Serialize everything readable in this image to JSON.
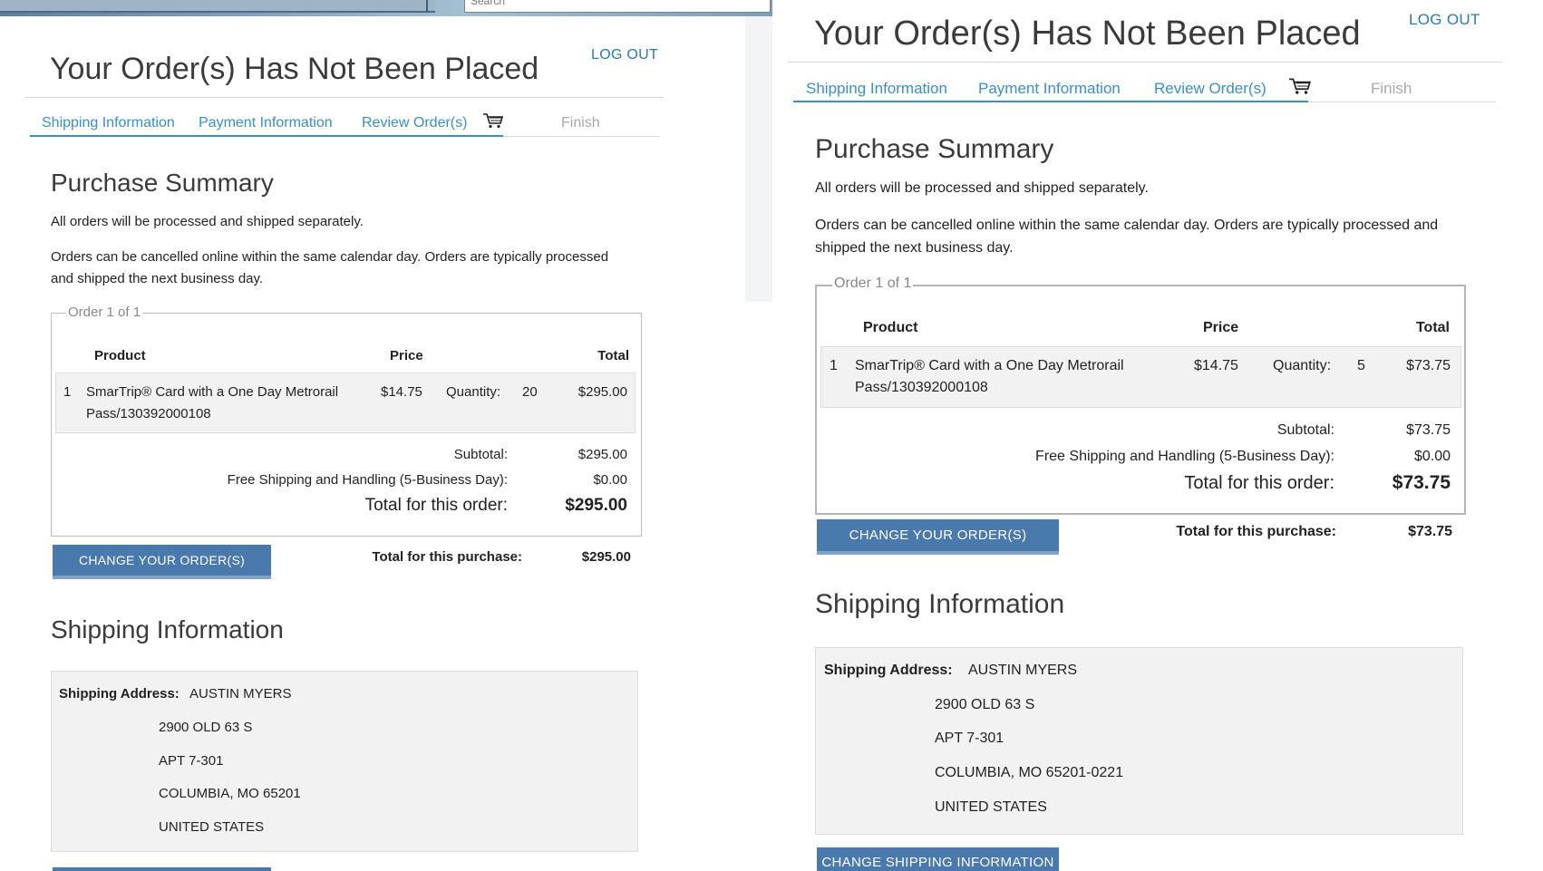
{
  "browser": {
    "search_placeholder": "Search"
  },
  "left": {
    "title": "Your Order(s) Has Not Been Placed",
    "logout": "LOG OUT",
    "steps": [
      "Shipping Information",
      "Payment Information",
      "Review Order(s)",
      "Finish"
    ],
    "summary_heading": "Purchase Summary",
    "note1": "All orders will be processed and shipped separately.",
    "note2": "Orders can be cancelled online within the same calendar day. Orders are typically processed and shipped the next business day.",
    "order_legend": "Order 1 of 1",
    "headers": {
      "product": "Product",
      "price": "Price",
      "total": "Total"
    },
    "item": {
      "index": "1",
      "product": "SmarTrip® Card with a One Day Metrorail Pass/130392000108",
      "price": "$14.75",
      "quantity_label": "Quantity:",
      "quantity": "20",
      "total": "$295.00"
    },
    "subtotal_label": "Subtotal:",
    "subtotal": "$295.00",
    "shipping_label": "Free Shipping and Handling (5-Business Day):",
    "shipping": "$0.00",
    "order_total_label": "Total for this order:",
    "order_total": "$295.00",
    "change_order_button": "CHANGE YOUR ORDER(S)",
    "purchase_total_label": "Total for this purchase:",
    "purchase_total": "$295.00",
    "shipping_heading": "Shipping Information",
    "address_label": "Shipping Address:",
    "address": [
      "AUSTIN MYERS",
      "2900 OLD 63 S",
      "APT 7-301",
      "COLUMBIA, MO 65201",
      "UNITED STATES"
    ]
  },
  "right": {
    "title": "Your Order(s) Has Not Been Placed",
    "logout": "LOG OUT",
    "steps": [
      "Shipping Information",
      "Payment Information",
      "Review Order(s)",
      "Finish"
    ],
    "summary_heading": "Purchase Summary",
    "note1": "All orders will be processed and shipped separately.",
    "note2": "Orders can be cancelled online within the same calendar day. Orders are typically processed and shipped the next business day.",
    "order_legend": "Order 1 of 1",
    "headers": {
      "product": "Product",
      "price": "Price",
      "total": "Total"
    },
    "item": {
      "index": "1",
      "product": "SmarTrip® Card with a One Day Metrorail Pass/130392000108",
      "price": "$14.75",
      "quantity_label": "Quantity:",
      "quantity": "5",
      "total": "$73.75"
    },
    "subtotal_label": "Subtotal:",
    "subtotal": "$73.75",
    "shipping_label": "Free Shipping and Handling (5-Business Day):",
    "shipping": "$0.00",
    "order_total_label": "Total for this order:",
    "order_total": "$73.75",
    "change_order_button": "CHANGE YOUR ORDER(S)",
    "purchase_total_label": "Total for this purchase:",
    "purchase_total": "$73.75",
    "shipping_heading": "Shipping Information",
    "address_label": "Shipping Address:",
    "address": [
      "AUSTIN MYERS",
      "2900 OLD 63 S",
      "APT 7-301",
      "COLUMBIA, MO 65201-0221",
      "UNITED STATES"
    ],
    "change_shipping_button": "CHANGE SHIPPING INFORMATION"
  },
  "colors": {
    "link": "#3a8fc7",
    "button": "#4a7aad",
    "logout": "#2a7ab5"
  },
  "icons": [
    "cart-icon"
  ]
}
